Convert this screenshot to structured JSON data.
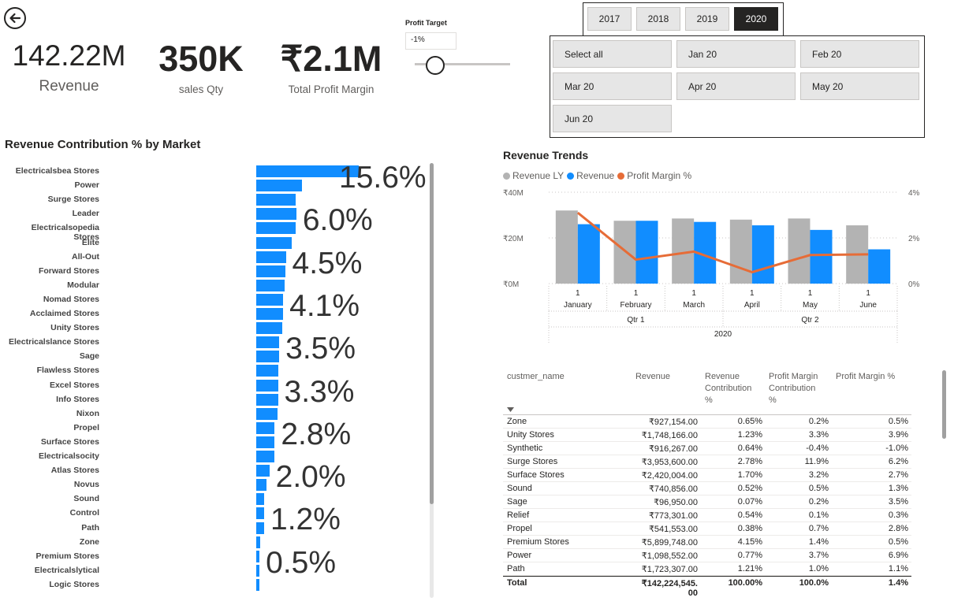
{
  "nav": {
    "back_icon": "arrow-left-circle-icon"
  },
  "kpis": [
    {
      "value": "142.22M",
      "label": "Revenue"
    },
    {
      "value": "350K",
      "label": "sales Qty"
    },
    {
      "value": "₹2.1M",
      "label": "Total Profit Margin"
    }
  ],
  "profit_target": {
    "label": "Profit Target",
    "value": "-1%"
  },
  "year_slicer": {
    "options": [
      "2017",
      "2018",
      "2019",
      "2020"
    ],
    "selected": "2020"
  },
  "month_slicer": {
    "options": [
      "Select all",
      "Jan 20",
      "Feb 20",
      "Mar 20",
      "Apr 20",
      "May 20",
      "Jun 20"
    ]
  },
  "colors": {
    "bar": "#118dff",
    "revenue_ly": "#b3b3b3",
    "profit_line": "#e66c37",
    "selected": "#252423"
  },
  "market_chart": {
    "title": "Revenue Contribution % by Market",
    "markets": [
      "Electricalsbea Stores",
      "Power",
      "Surge Stores",
      "Leader",
      "Electricalsopedia Stores",
      "Elite",
      "All-Out",
      "Forward Stores",
      "Modular",
      "Nomad Stores",
      "Acclaimed Stores",
      "Unity Stores",
      "Electricalslance Stores",
      "Sage",
      "Flawless Stores",
      "Excel Stores",
      "Info Stores",
      "Nixon",
      "Propel",
      "Surface Stores",
      "Electricalsocity",
      "Atlas Stores",
      "Novus",
      "Sound",
      "Control",
      "Path",
      "Zone",
      "Premium Stores",
      "Electricalslytical",
      "Logic Stores"
    ],
    "values": [
      15.6,
      7.0,
      6.0,
      6.1,
      6.0,
      5.4,
      4.5,
      4.4,
      4.3,
      4.1,
      4.1,
      3.9,
      3.5,
      3.5,
      3.3,
      3.3,
      3.3,
      3.2,
      2.8,
      2.8,
      2.7,
      2.0,
      1.6,
      1.2,
      1.2,
      1.2,
      0.6,
      0.5,
      0.5,
      0.5
    ],
    "labels": [
      "15.6%",
      "6.0%",
      "4.5%",
      "4.1%",
      "3.5%",
      "3.3%",
      "2.8%",
      "2.0%",
      "1.2%",
      "0.5%"
    ]
  },
  "chart_data": {
    "type": "bar",
    "title": "Revenue Trends",
    "categories": [
      "January",
      "February",
      "March",
      "April",
      "May",
      "June"
    ],
    "x_upper": [
      "1",
      "1",
      "1",
      "1",
      "1",
      "1"
    ],
    "quarters": [
      "Qtr 1",
      "Qtr 2"
    ],
    "year": "2020",
    "series": [
      {
        "name": "Revenue LY",
        "values": [
          32,
          27.5,
          28.5,
          28,
          28.5,
          25.5
        ]
      },
      {
        "name": "Revenue",
        "values": [
          26,
          27.5,
          27,
          25.5,
          23.5,
          15
        ]
      },
      {
        "name": "Profit Margin %",
        "values": [
          3.1,
          1.05,
          1.4,
          0.5,
          1.25,
          1.28
        ],
        "axis": "right"
      }
    ],
    "y_left_ticks": [
      "₹40M",
      "₹20M",
      "₹0M"
    ],
    "y_right_ticks": [
      "4%",
      "2%",
      "0%"
    ],
    "ylim": [
      0,
      40
    ],
    "ylim_right": [
      0,
      4
    ],
    "legend": "top-left"
  },
  "table": {
    "headers": [
      "custmer_name",
      "Revenue",
      "Revenue Contribution %",
      "Profit Margin Contribution %",
      "Profit Margin %"
    ],
    "header_lines": [
      [
        "custmer_name"
      ],
      [
        "Revenue"
      ],
      [
        "Revenue",
        "Contribution",
        "%"
      ],
      [
        "Profit Margin",
        "Contribution",
        "%"
      ],
      [
        "Profit Margin %"
      ]
    ],
    "rows": [
      [
        "Zone",
        "₹927,154.00",
        "0.65%",
        "0.2%",
        "0.5%"
      ],
      [
        "Unity Stores",
        "₹1,748,166.00",
        "1.23%",
        "3.3%",
        "3.9%"
      ],
      [
        "Synthetic",
        "₹916,267.00",
        "0.64%",
        "-0.4%",
        "-1.0%"
      ],
      [
        "Surge Stores",
        "₹3,953,600.00",
        "2.78%",
        "11.9%",
        "6.2%"
      ],
      [
        "Surface Stores",
        "₹2,420,004.00",
        "1.70%",
        "3.2%",
        "2.7%"
      ],
      [
        "Sound",
        "₹740,856.00",
        "0.52%",
        "0.5%",
        "1.3%"
      ],
      [
        "Sage",
        "₹96,950.00",
        "0.07%",
        "0.2%",
        "3.5%"
      ],
      [
        "Relief",
        "₹773,301.00",
        "0.54%",
        "0.1%",
        "0.3%"
      ],
      [
        "Propel",
        "₹541,553.00",
        "0.38%",
        "0.7%",
        "2.8%"
      ],
      [
        "Premium Stores",
        "₹5,899,748.00",
        "4.15%",
        "1.4%",
        "0.5%"
      ],
      [
        "Power",
        "₹1,098,552.00",
        "0.77%",
        "3.7%",
        "6.9%"
      ],
      [
        "Path",
        "₹1,723,307.00",
        "1.21%",
        "1.0%",
        "1.1%"
      ]
    ],
    "total": [
      "Total",
      "₹142,224,545.",
      "100.00%",
      "100.0%",
      "1.4%"
    ],
    "total_wrap": "00"
  }
}
